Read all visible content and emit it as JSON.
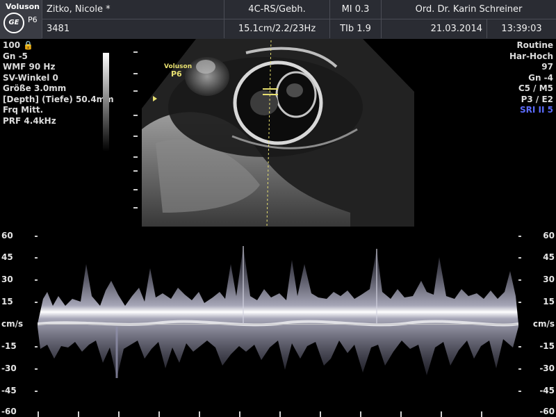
{
  "header": {
    "brand": "Voluson",
    "logo_text": "GE",
    "probe": "P6",
    "patient_name": "Zitko, Nicole  *",
    "patient_id": "3481",
    "preset": "4C-RS/Gebh.",
    "depth_info": "15.1cm/2.2/23Hz",
    "mi": "MI  0.3",
    "tib": "TIb  1.9",
    "operator": "Ord. Dr. Karin Schreiner",
    "date": "21.03.2014",
    "time": "13:39:03"
  },
  "image_overlay": {
    "brand": "Voluson",
    "probe": "P6"
  },
  "left_params": [
    "100 🔒",
    "Gn  -5",
    "WMF 90 Hz",
    "SV-Winkel  0",
    "Größe  3.0mm",
    "[Depth] (Tiefe) 50.4mm",
    "Frq Mitt.",
    "PRF  4.4kHz"
  ],
  "right_params": [
    "Routine",
    "Har-Hoch",
    "97",
    "Gn  -4",
    "C5 / M5",
    "P3 / E2",
    "SRI II 5"
  ],
  "doppler_scale": {
    "unit": "cm/s",
    "ticks": [
      "60",
      "45",
      "30",
      "15",
      "-15",
      "-30",
      "-45",
      "-60"
    ]
  },
  "colors": {
    "header_bg": "#2a2c33",
    "sri_text": "#5c6cff",
    "marker": "#e8e070"
  }
}
